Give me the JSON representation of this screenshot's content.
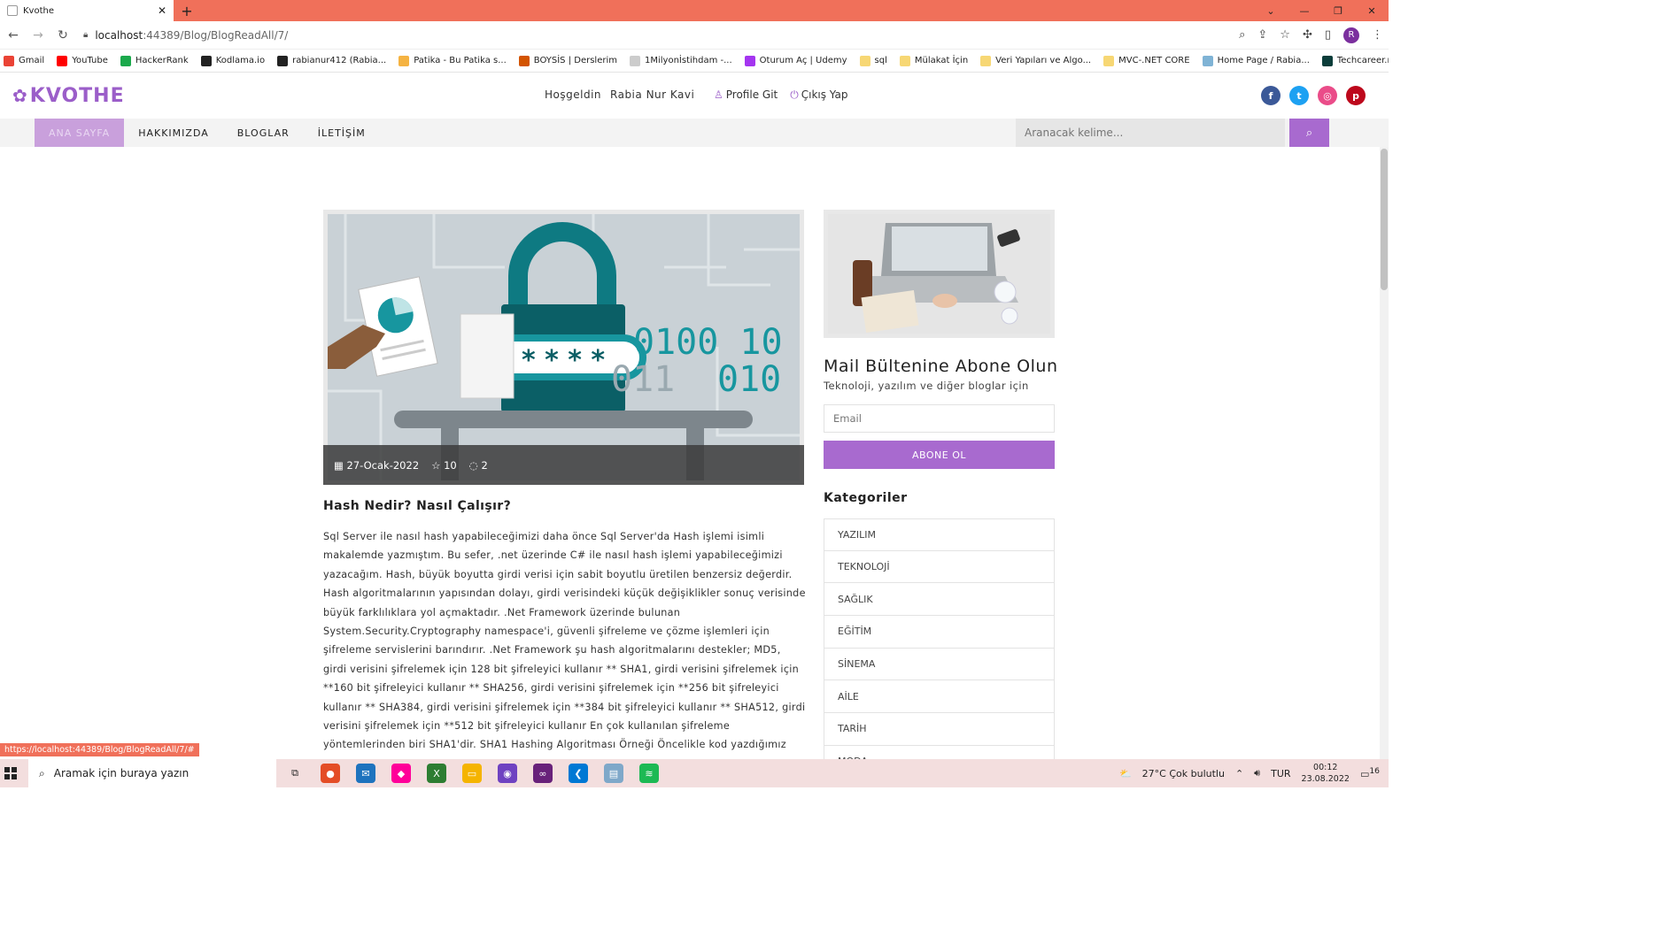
{
  "browser": {
    "tab_title": "Kvothe",
    "url_host": "localhost",
    "url_path": ":44389/Blog/BlogReadAll/7/",
    "profile_initial": "R",
    "bookmarks": [
      {
        "label": "Gmail",
        "color": "#ea4335"
      },
      {
        "label": "YouTube",
        "color": "#ff0000"
      },
      {
        "label": "HackerRank",
        "color": "#1ba94c"
      },
      {
        "label": "Kodlama.io",
        "color": "#222222"
      },
      {
        "label": "rabianur412 (Rabia...",
        "color": "#222222"
      },
      {
        "label": "Patika - Bu Patika s...",
        "color": "#f5b342"
      },
      {
        "label": "BOYSİS | Derslerim",
        "color": "#d35400"
      },
      {
        "label": "1Milyonİstihdam -...",
        "color": "#cccccc"
      },
      {
        "label": "Oturum Aç | Udemy",
        "color": "#a435f0"
      },
      {
        "label": "sql",
        "color": "#f7d774"
      },
      {
        "label": "Mülakat İçin",
        "color": "#f7d774"
      },
      {
        "label": "Veri Yapıları ve Algo...",
        "color": "#f7d774"
      },
      {
        "label": "MVC-.NET CORE",
        "color": "#f7d774"
      },
      {
        "label": "Home Page / Rabia...",
        "color": "#7fb3d5"
      },
      {
        "label": "Techcareer.net - Ha...",
        "color": "#0b3d3a"
      }
    ]
  },
  "header": {
    "logo": "KVOTHE",
    "welcome": "Hoşgeldin",
    "username": "Rabia Nur Kavi",
    "profile_link": "Profile Git",
    "logout_link": "Çıkış Yap"
  },
  "menu": {
    "items": [
      "ANA SAYFA",
      "HAKKIMIZDA",
      "BLOGLAR",
      "İLETİŞİM"
    ],
    "search_placeholder": "Aranacak kelime..."
  },
  "post": {
    "date": "27-Ocak-2022",
    "rating": "10",
    "comments": "2",
    "title": "Hash Nedir? Nasıl Çalışır?",
    "body": "Sql Server ile nasıl hash yapabileceğimizi daha önce Sql Server'da Hash işlemi isimli makalemde yazmıştım. Bu sefer, .net üzerinde C# ile nasıl hash işlemi yapabileceğimizi yazacağım. Hash, büyük boyutta girdi verisi için sabit boyutlu üretilen benzersiz değerdir. Hash algoritmalarının yapısından dolayı, girdi verisindeki küçük değişiklikler sonuç verisinde büyük farklılıklara yol açmaktadır. .Net Framework üzerinde bulunan System.Security.Cryptography namespace'i, güvenli şifreleme ve çözme işlemleri için şifreleme servislerini barındırır. .Net Framework şu hash algoritmalarını destekler; MD5, girdi verisini şifrelemek için 128 bit şifreleyici kullanır ** SHA1, girdi verisini şifrelemek için **160 bit şifreleyici kullanır ** SHA256, girdi verisini şifrelemek için **256 bit şifreleyici kullanır ** SHA384, girdi verisini şifrelemek için **384 bit şifreleyici kullanır ** SHA512, girdi verisini şifrelemek için **512 bit şifreleyici kullanır En çok kullanılan şifreleme yöntemlerinden biri SHA1'dir. SHA1 Hashing Algoritması Örneği Öncelikle kod yazdığımız"
  },
  "sidebar": {
    "newsletter_title": "Mail Bültenine Abone Olun",
    "newsletter_sub": "Teknoloji, yazılım ve diğer bloglar için",
    "email_placeholder": "Email",
    "subscribe_label": "ABONE OL",
    "categories_title": "Kategoriler",
    "categories": [
      "YAZILIM",
      "TEKNOLOJİ",
      "SAĞLIK",
      "EĞİTİM",
      "SİNEMA",
      "AİLE",
      "TARİH",
      "MODA"
    ]
  },
  "status_url": "https://localhost:44389/Blog/BlogReadAll/7/#",
  "taskbar": {
    "search_placeholder": "Aramak için buraya yazın",
    "weather": "27°C  Çok bulutlu",
    "lang": "TUR",
    "time": "00:12",
    "date": "23.08.2022",
    "notif": "16"
  },
  "colors": {
    "accent": "#a86acf",
    "browser_chrome": "#f0705a"
  }
}
